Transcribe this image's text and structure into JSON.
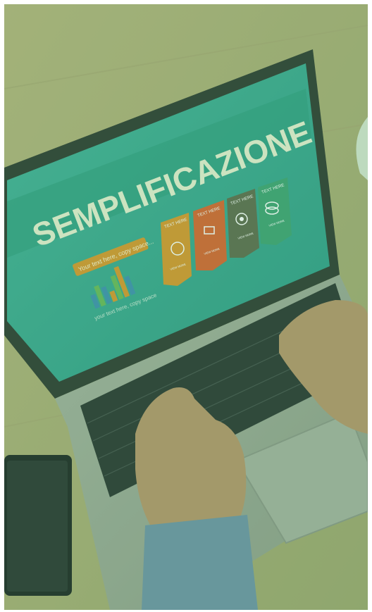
{
  "screen": {
    "title": "SEMPLIFICAZIONE",
    "banner_text": "Your text here, copy space...",
    "sub_text": "your text here, copy space",
    "cards": [
      {
        "label": "TEXT HERE",
        "button": "VIEW MORE",
        "icon": "globe-icon",
        "color": "#d9962b"
      },
      {
        "label": "TEXT HERE",
        "button": "VIEW MORE",
        "icon": "presentation-icon",
        "color": "#d9632e"
      },
      {
        "label": "TEXT HERE",
        "button": "VIEW MORE",
        "icon": "target-icon",
        "color": "#5f6b4d"
      },
      {
        "label": "TEXT HERE",
        "button": "VIEW MORE",
        "icon": "stack-icon",
        "color": "#3fa273"
      }
    ]
  },
  "colors": {
    "overlay": "#3db88a",
    "screen_bg": "#3aa693",
    "desk": "#b9b07c"
  }
}
